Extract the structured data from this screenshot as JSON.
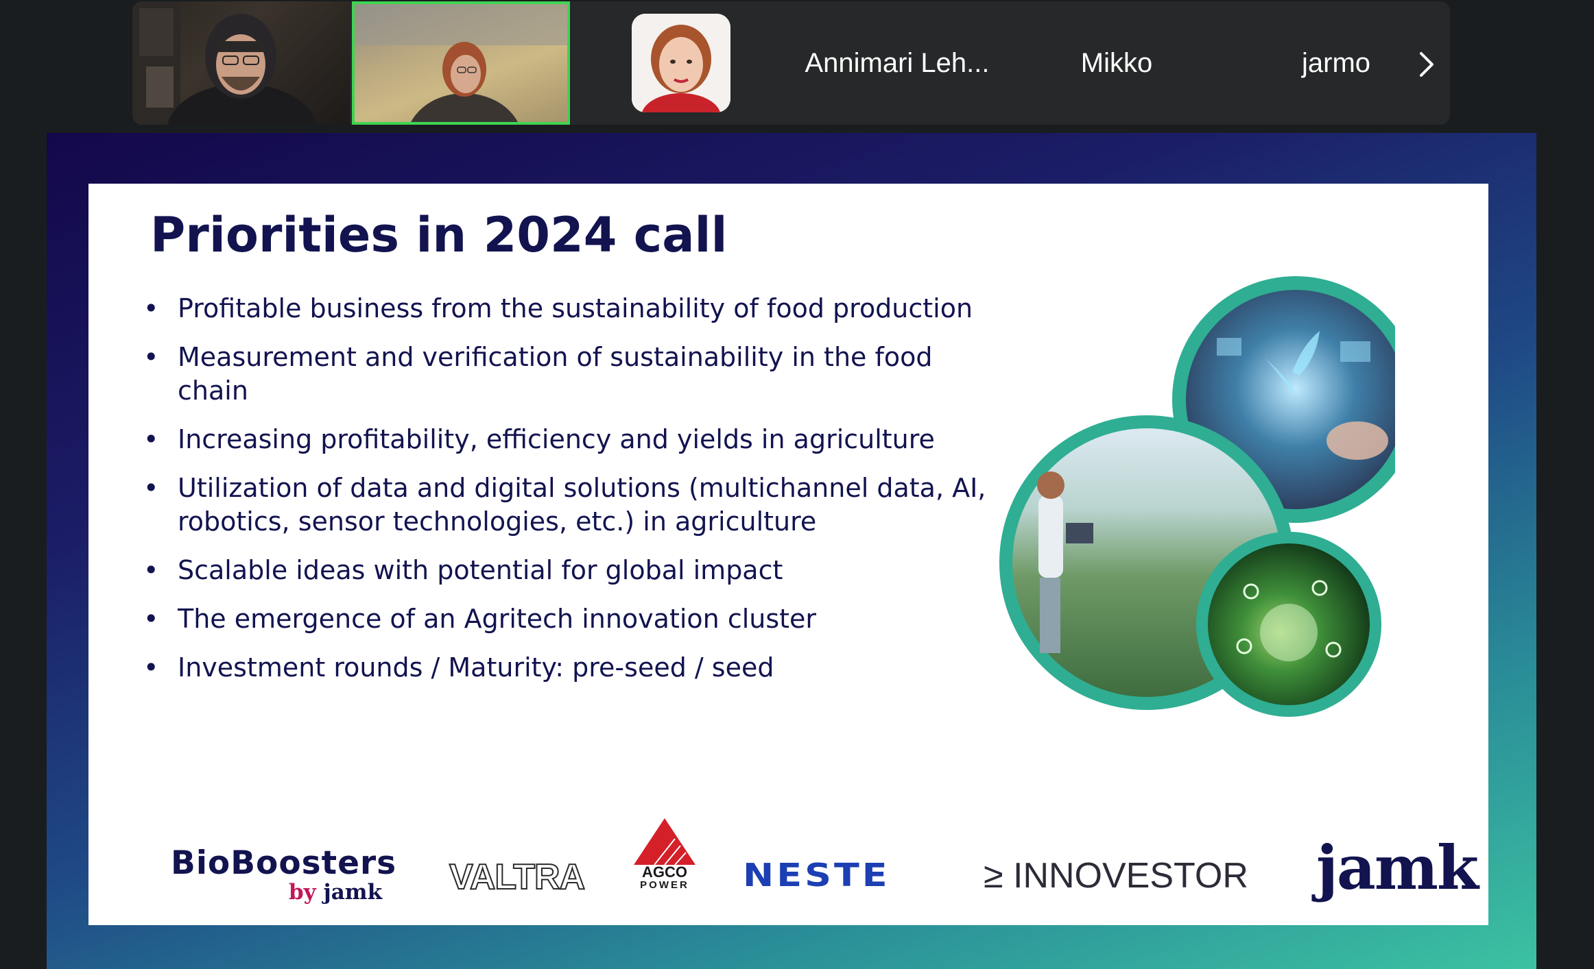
{
  "meeting": {
    "participants": [
      {
        "type": "video",
        "desc": ""
      },
      {
        "type": "video",
        "active_speaker": true
      },
      {
        "type": "avatar"
      },
      {
        "type": "name",
        "name": "Annimari Leh..."
      },
      {
        "type": "name",
        "name": "Mikko"
      },
      {
        "type": "name",
        "name": "jarmo"
      }
    ],
    "next_page_icon": "chevron-right-icon",
    "active_speaker_color": "#3fd451"
  },
  "slide": {
    "title": "Priorities in 2024 call",
    "bullets": [
      "Profitable business from the sustainability of food production",
      "Measurement and verification of sustainability in the food chain",
      "Increasing profitability, efficiency and yields in agriculture",
      "Utilization of data and digital solutions (multichannel data, AI, robotics, sensor technologies, etc.) in agriculture",
      "Scalable ideas with potential for global impact",
      "The emergence of an Agritech innovation cluster",
      "Investment rounds / Maturity: pre-seed / seed"
    ],
    "bullet_symbol": "•",
    "title_color": "#12134f",
    "circle_ring_color": "#2fae93",
    "logos": {
      "bioboosters_main": "BioBoosters",
      "bioboosters_by": "by",
      "bioboosters_jamk": "jamk",
      "valtra": "VALTRA",
      "agco_line1": "AGCO",
      "agco_line2": "POWER",
      "neste": "NESTE",
      "innovestor_symbol": "≥",
      "innovestor": "INNOVESTOR",
      "jamk": "jamk"
    }
  }
}
